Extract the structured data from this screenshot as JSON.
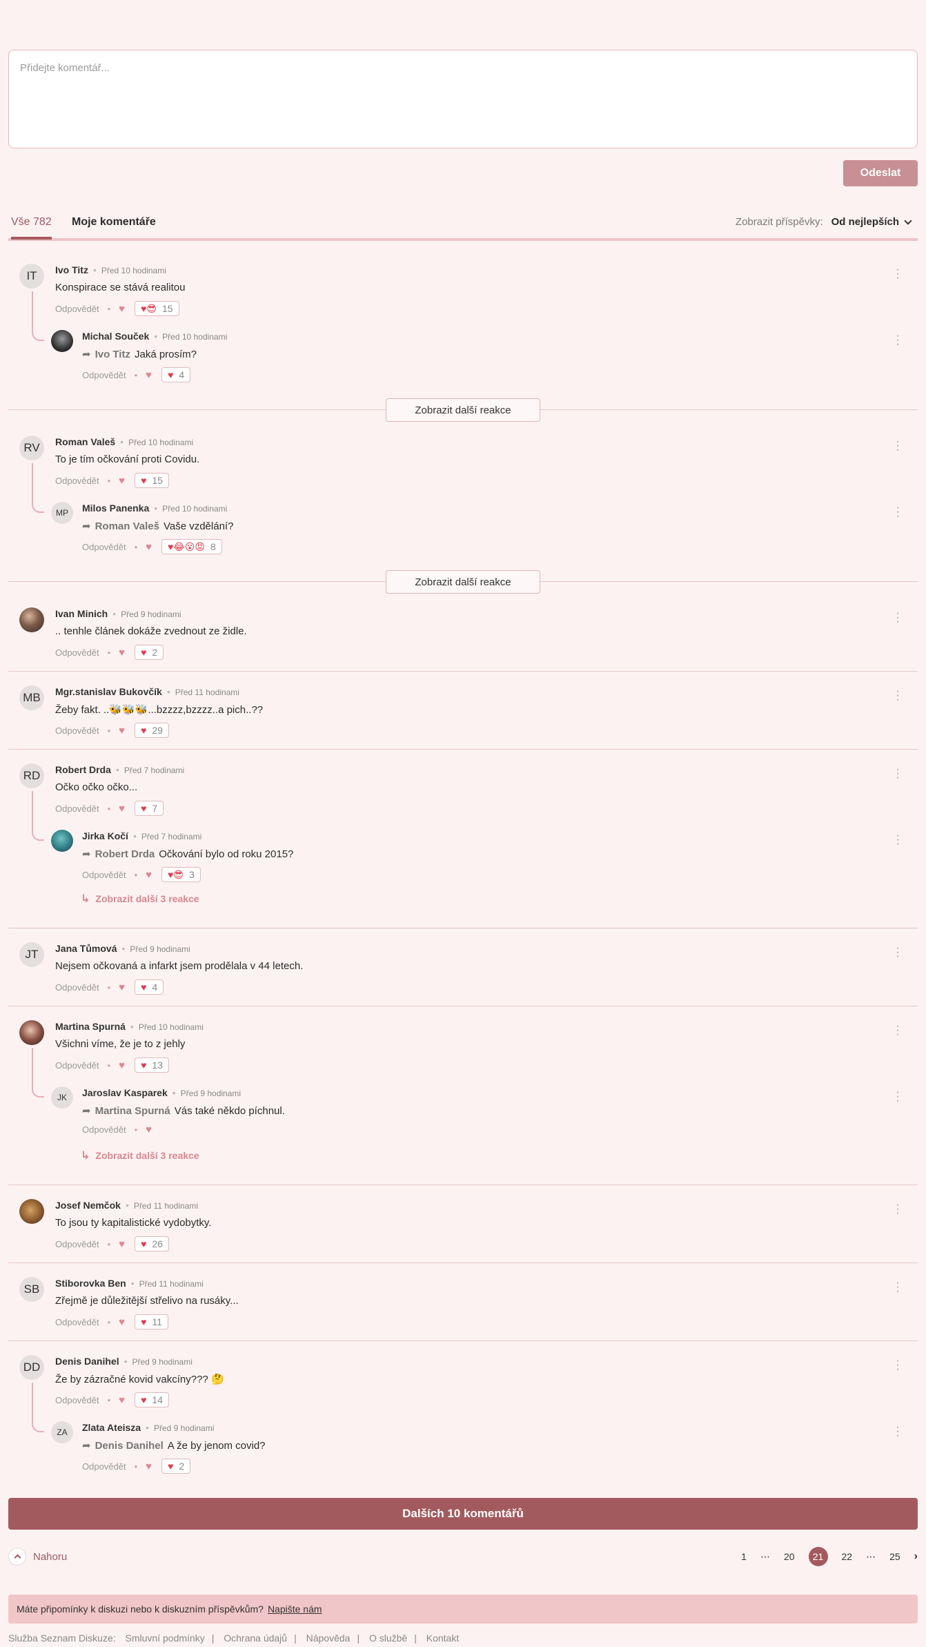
{
  "composer": {
    "placeholder": "Přidejte komentář...",
    "submit_label": "Odeslat"
  },
  "tabs": {
    "all_label": "Vše",
    "all_count": "782",
    "mine_label": "Moje komentáře"
  },
  "sort": {
    "label": "Zobrazit příspěvky:",
    "value": "Od nejlepších"
  },
  "reply_label": "Odpovědět",
  "show_more_reactions": "Zobrazit další reakce",
  "comments": [
    {
      "initials": "IT",
      "author": "Ivo Titz",
      "time": "Před 10 hodinami",
      "text": "Konspirace se stává realitou",
      "reactions": "15"
    },
    {
      "initials": "",
      "author": "Michal Souček",
      "time": "Před 10 hodinami",
      "reply_to": "Ivo Titz",
      "text": "Jaká prosím?",
      "reactions": "4"
    },
    {
      "initials": "RV",
      "author": "Roman Valeš",
      "time": "Před 10 hodinami",
      "text": "To je tím očkování proti Covidu.",
      "reactions": "15"
    },
    {
      "initials": "MP",
      "author": "Milos Panenka",
      "time": "Před 10 hodinami",
      "reply_to": "Roman Valeš",
      "text": "Vaše vzdělání?",
      "reactions": "8"
    },
    {
      "initials": "",
      "author": "Ivan Minich",
      "time": "Před 9 hodinami",
      "text": ".. tenhle článek dokáže zvednout ze židle.",
      "reactions": "2"
    },
    {
      "initials": "MB",
      "author": "Mgr.stanislav Bukovčík",
      "time": "Před 11 hodinami",
      "text": "Žeby fakt. ..🐝🐝🐝...bzzzz,bzzzz..a pich..??",
      "reactions": "29"
    },
    {
      "initials": "RD",
      "author": "Robert Drda",
      "time": "Před 7 hodinami",
      "text": "Očko očko očko...",
      "reactions": "7"
    },
    {
      "initials": "",
      "author": "Jirka Kočí",
      "time": "Před 7 hodinami",
      "reply_to": "Robert Drda",
      "text": "Očkování bylo od roku 2015?",
      "reactions": "3",
      "more_replies": "Zobrazit další 3 reakce"
    },
    {
      "initials": "JT",
      "author": "Jana Tůmová",
      "time": "Před 9 hodinami",
      "text": "Nejsem očkovaná a infarkt jsem prodělala v 44 letech.",
      "reactions": "4"
    },
    {
      "initials": "",
      "author": "Martina Spurná",
      "time": "Před 10 hodinami",
      "text": "Všichni víme, že je to z jehly",
      "reactions": "13"
    },
    {
      "initials": "JK",
      "author": "Jaroslav Kasparek",
      "time": "Před 9 hodinami",
      "reply_to": "Martina Spurná",
      "text": "Vás také někdo píchnul.",
      "reactions": "",
      "more_replies": "Zobrazit další 3 reakce"
    },
    {
      "initials": "",
      "author": "Josef Nemčok",
      "time": "Před 11 hodinami",
      "text": "To jsou ty kapitalistické vydobytky.",
      "reactions": "26"
    },
    {
      "initials": "SB",
      "author": "Stiborovka Ben",
      "time": "Před 11 hodinami",
      "text": "Zřejmě je důležitější střelivo na rusáky...",
      "reactions": "11"
    },
    {
      "initials": "DD",
      "author": "Denis Danihel",
      "time": "Před 9 hodinami",
      "text": "Že by zázračné kovid vakcíny??? 🤔",
      "reactions": "14"
    },
    {
      "initials": "ZA",
      "author": "Zlata Ateisza",
      "time": "Před 9 hodinami",
      "reply_to": "Denis Danihel",
      "text": "A že by jenom covid?",
      "reactions": "2"
    }
  ],
  "more_comments_label": "Dalších 10 komentářů",
  "top_label": "Nahoru",
  "pagination": {
    "pages": [
      "1",
      "⋯",
      "20",
      "21",
      "22",
      "⋯",
      "25"
    ],
    "current": "21",
    "next": "›"
  },
  "feedback": {
    "text": "Máte připomínky k diskuzi nebo k diskuzním příspěvkům?",
    "link": "Napište nám"
  },
  "footer": {
    "service": "Služba Seznam Diskuze:",
    "links": [
      "Smluvní podmínky",
      "Ochrana údajů",
      "Nápověda",
      "O službě",
      "Kontakt"
    ]
  },
  "colors": {
    "accent": "#a35a5f",
    "background": "#fdf2f2",
    "heart": "#e23a4a"
  }
}
